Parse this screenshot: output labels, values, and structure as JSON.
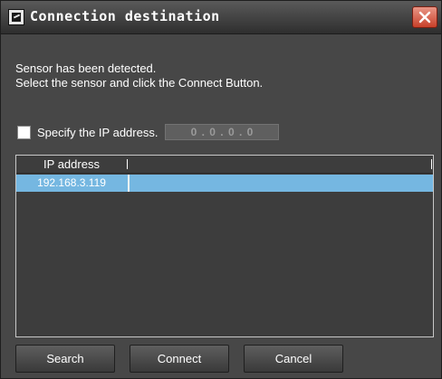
{
  "window": {
    "title": "Connection destination",
    "close_label": "×"
  },
  "message": {
    "line1": "Sensor has been detected.",
    "line2": "Select the sensor and click the Connect Button."
  },
  "ip_option": {
    "label": "Specify the IP address.",
    "checked": false,
    "value": "0 . 0 . 0 . 0"
  },
  "table": {
    "columns": [
      "IP address"
    ],
    "rows": [
      {
        "ip": "192.168.3.119",
        "selected": true
      }
    ]
  },
  "buttons": {
    "search": "Search",
    "connect": "Connect",
    "cancel": "Cancel"
  },
  "colors": {
    "selection": "#75b7e1",
    "close_button": "#c8402a",
    "background": "#474747"
  }
}
